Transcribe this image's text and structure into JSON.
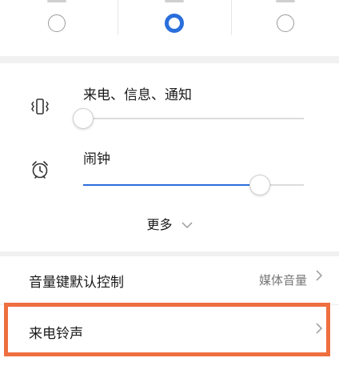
{
  "mode_options": [
    {
      "selected": false
    },
    {
      "selected": true
    },
    {
      "selected": false
    }
  ],
  "volume": {
    "items": [
      {
        "label": "来电、信息、通知",
        "icon": "vibrate-icon",
        "level": 0.0
      },
      {
        "label": "闹钟",
        "icon": "alarm-clock-icon",
        "level": 0.8
      }
    ],
    "more_label": "更多",
    "more_icon": "chevron-down-icon"
  },
  "settings": [
    {
      "title": "音量键默认控制",
      "value": "媒体音量"
    },
    {
      "title": "来电铃声",
      "value": ""
    }
  ],
  "colors": {
    "accent": "#2a6fdb",
    "highlight_border": "#ee6f3f",
    "section_gap": "#f1f1f1"
  }
}
